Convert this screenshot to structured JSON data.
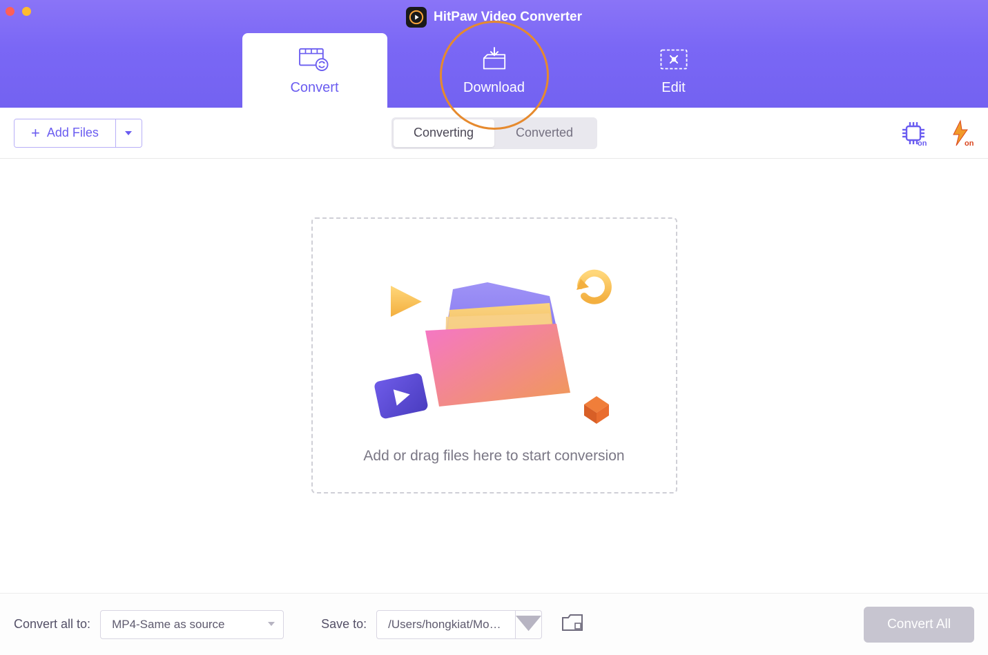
{
  "app": {
    "title": "HitPaw Video Converter"
  },
  "tabs": {
    "convert": {
      "label": "Convert"
    },
    "download": {
      "label": "Download"
    },
    "edit": {
      "label": "Edit"
    }
  },
  "toolbar": {
    "add_files": "Add Files",
    "seg_converting": "Converting",
    "seg_converted": "Converted",
    "hw_accel_badge": "on",
    "lightning_badge": "on"
  },
  "drop": {
    "msg": "Add or drag files here to start conversion"
  },
  "footer": {
    "convert_all_to_label": "Convert all to:",
    "format_value": "MP4-Same as source",
    "save_to_label": "Save to:",
    "save_path": "/Users/hongkiat/Movies/…",
    "convert_all_btn": "Convert All"
  },
  "colors": {
    "accent": "#6a5cf0",
    "orange": "#e68a2e"
  }
}
